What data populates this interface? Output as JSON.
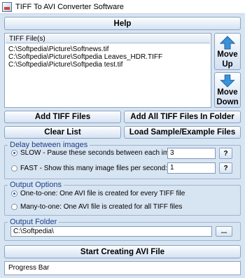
{
  "window": {
    "title": "TIFF To AVI Converter Software"
  },
  "help_label": "Help",
  "files": {
    "header": "TIFF File(s)",
    "items": [
      "C:\\Softpedia\\Picture\\Softnews.tif",
      "C:\\Softpedia\\Picture\\Softpedia Leaves_HDR.TIFF",
      "C:\\Softpedia\\Picture\\Softpedia test.tif"
    ]
  },
  "move_up": {
    "line1": "Move",
    "line2": "Up"
  },
  "move_down": {
    "line1": "Move",
    "line2": "Down"
  },
  "buttons": {
    "add_tiff": "Add TIFF Files",
    "add_folder": "Add All TIFF Files In Folder",
    "clear": "Clear List",
    "load_sample": "Load Sample/Example Files",
    "start": "Start Creating AVI File",
    "browse": "...",
    "help_q": "?"
  },
  "delay": {
    "label": "Delay between images",
    "slow_label": "SLOW - Pause these seconds between each image file:",
    "slow_value": "3",
    "fast_label": "FAST - Show this many image files per second:",
    "fast_value": "1",
    "selected": "slow"
  },
  "output_options": {
    "label": "Output Options",
    "one_to_one": "One-to-one: One AVI file is created for every TIFF file",
    "many_to_one": "Many-to-one: One AVI file is created for all TIFF files",
    "selected": "one_to_one"
  },
  "output_folder": {
    "label": "Output Folder",
    "value": "C:\\Softpedia\\"
  },
  "progress": {
    "label": "Progress Bar"
  },
  "colors": {
    "accent": "#1a3f8a",
    "arrow": "#3a93d8"
  }
}
